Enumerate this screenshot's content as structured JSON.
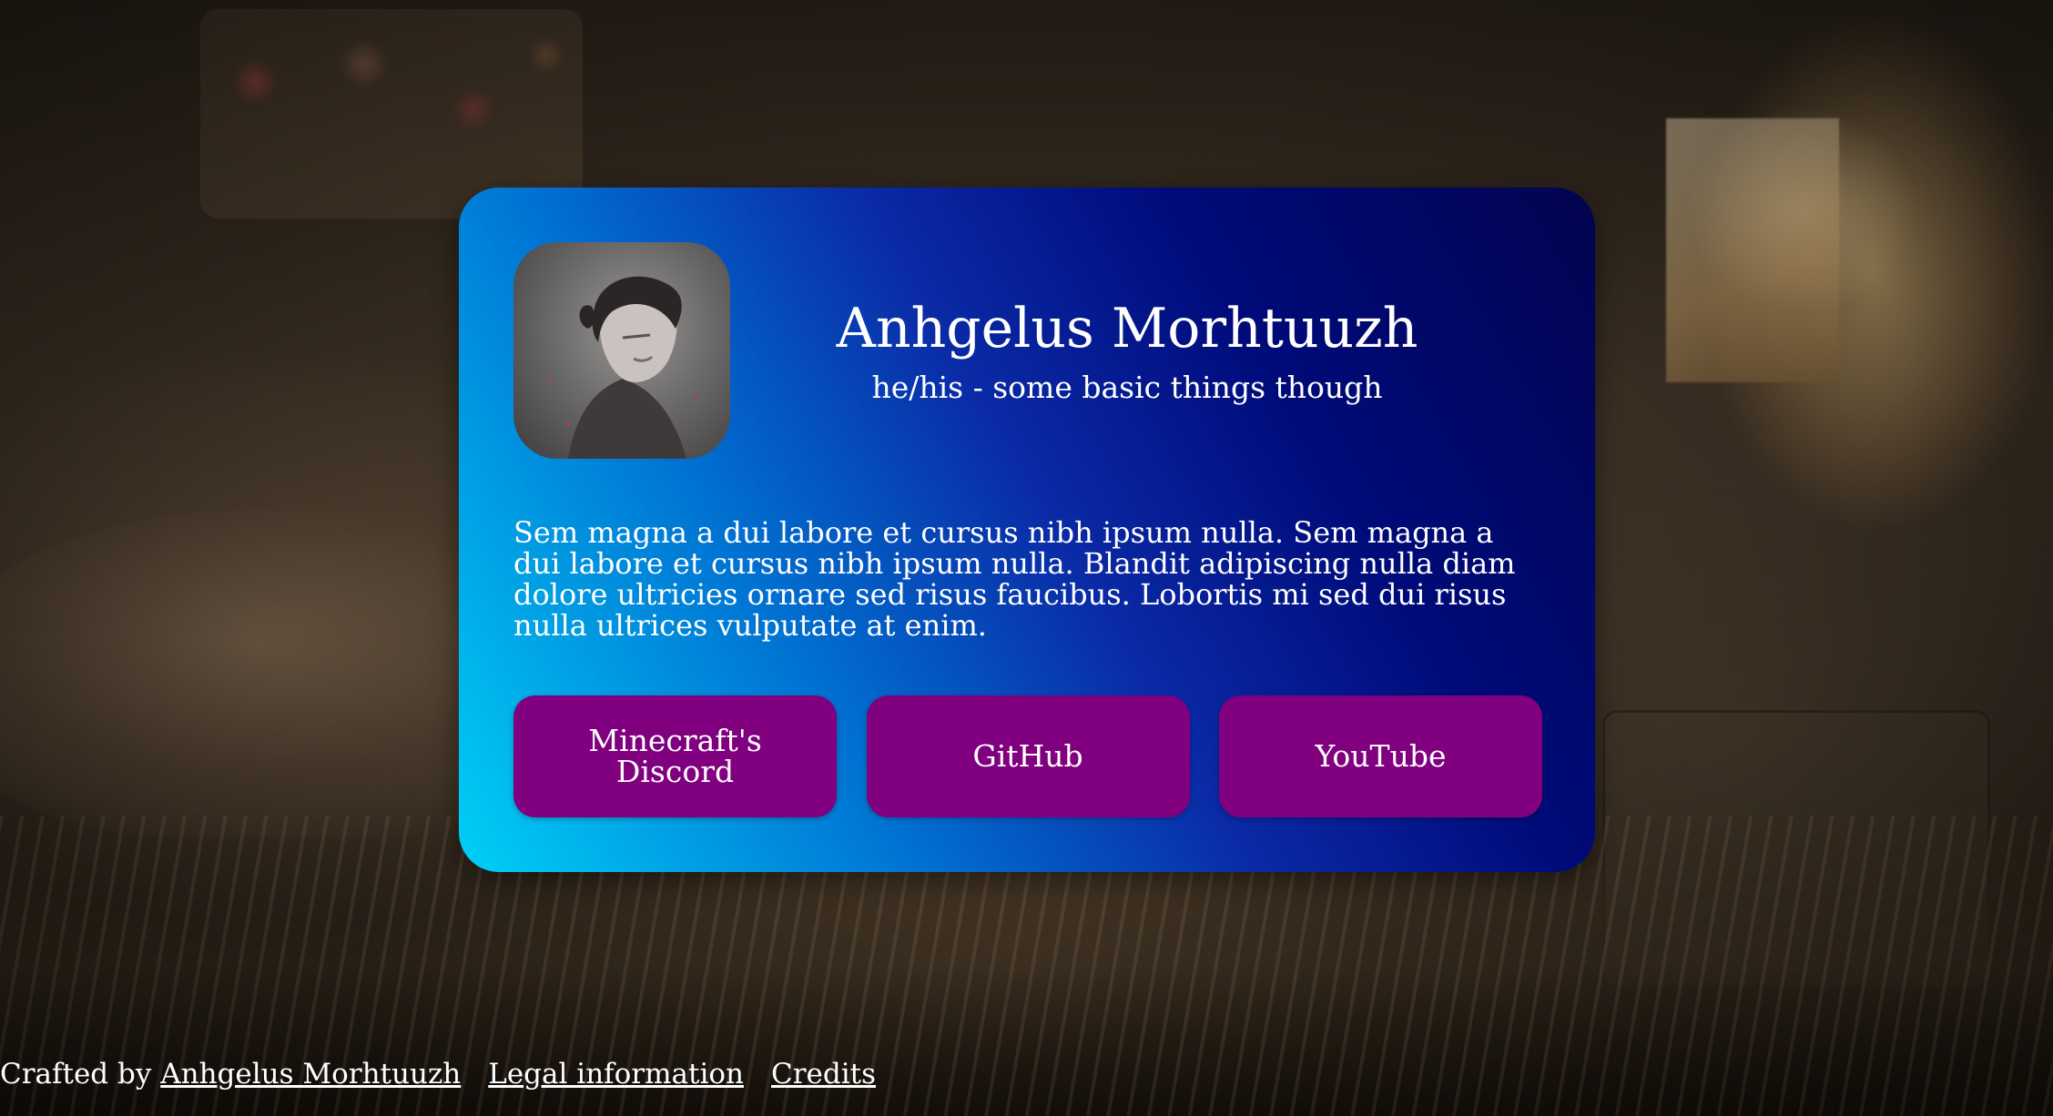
{
  "profile": {
    "name": "Anhgelus Morhtuuzh",
    "subtitle": "he/his - some basic things though",
    "bio": "Sem magna a dui labore et cursus nibh ipsum nulla. Sem magna a dui labore et cursus nibh ipsum nulla. Blandit adipiscing nulla diam dolore ultricies ornare sed risus faucibus. Lobortis mi sed dui risus nulla ultrices vulputate at enim."
  },
  "buttons": [
    {
      "label": "Minecraft's Discord"
    },
    {
      "label": "GitHub"
    },
    {
      "label": "YouTube"
    }
  ],
  "footer": {
    "crafted_by_prefix": "Crafted by ",
    "author_link": "Anhgelus Morhtuuzh",
    "legal_link": "Legal information",
    "credits_link": "Credits"
  },
  "colors": {
    "button_bg": "#800080",
    "card_gradient_start": "#00d0f7",
    "card_gradient_end": "#02034f",
    "text": "#ffffff"
  }
}
